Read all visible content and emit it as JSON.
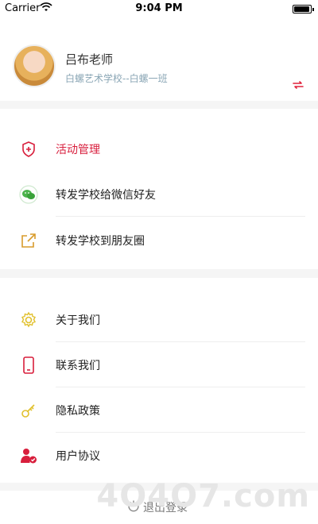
{
  "status": {
    "carrier": "Carrier",
    "time": "9:04 PM"
  },
  "profile": {
    "name": "吕布老师",
    "school": "白螺艺术学校--白螺一班"
  },
  "group1": {
    "items": [
      {
        "label": "活动管理",
        "icon": "shield-plus-icon",
        "color": "#d81e3c"
      },
      {
        "label": "转发学校给微信好友",
        "icon": "wechat-icon"
      },
      {
        "label": "转发学校到朋友圈",
        "icon": "share-icon"
      }
    ]
  },
  "group2": {
    "items": [
      {
        "label": "关于我们",
        "icon": "gear-icon"
      },
      {
        "label": "联系我们",
        "icon": "phone-icon"
      },
      {
        "label": "隐私政策",
        "icon": "key-icon"
      },
      {
        "label": "用户协议",
        "icon": "user-check-icon"
      }
    ]
  },
  "logout": {
    "label": "退出登录"
  },
  "watermark": "4O4O7.com",
  "colors": {
    "accent": "#d81e3c",
    "background": "#f5f5f5"
  }
}
